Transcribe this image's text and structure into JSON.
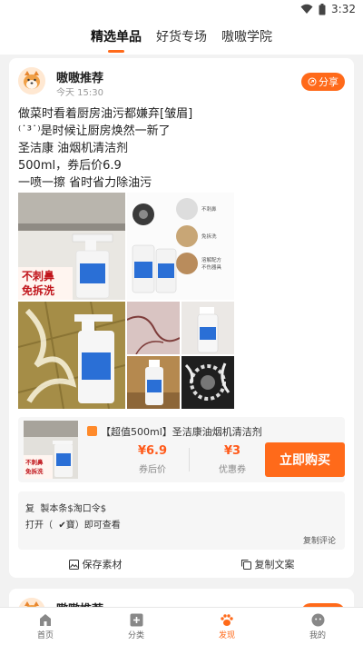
{
  "status_bar": {
    "time": "3:32"
  },
  "top_tabs": [
    {
      "label": "精选单品",
      "active": true
    },
    {
      "label": "好货专场",
      "active": false
    },
    {
      "label": "嗷嗷学院",
      "active": false
    }
  ],
  "post": {
    "author": "嗷嗷推荐",
    "time": "今天 15:30",
    "share_label": "分享",
    "text_lines": [
      "做菜时看着厨房油污都嫌弃[皱眉]",
      "⁽˙³˙⁾是时候让厨房焕然一新了",
      "圣洁康    油烟机清洁剂",
      "500ml，券后价6.9",
      "一喷一擦    省时省力除油污"
    ],
    "image_text": {
      "img1": [
        "不刺鼻",
        "免拆洗"
      ],
      "img2": [
        "不刺鼻",
        "免拆洗",
        "溶解配方",
        "不伤器具"
      ]
    }
  },
  "product": {
    "title": "【超值500ml】圣洁康油烟机清洁剂",
    "thumb_text": [
      "不刺鼻",
      "免拆洗"
    ],
    "after_coupon_price": "¥6.9",
    "after_coupon_label": "券后价",
    "coupon_value": "¥3",
    "coupon_label": "优惠券",
    "buy_label": "立即购买"
  },
  "copy_text": {
    "line1": "复  製本条$淘口令$",
    "line2": "打开（  ✔寶）即可查看",
    "comment_label": "复制评论"
  },
  "actions": {
    "save_label": "保存素材",
    "copy_label": "复制文案"
  },
  "next_post": {
    "author": "嗷嗷推荐"
  },
  "bottom_nav": [
    {
      "label": "首页",
      "icon": "home-icon",
      "active": false
    },
    {
      "label": "分类",
      "icon": "category-icon",
      "active": false
    },
    {
      "label": "发现",
      "icon": "paw-icon",
      "active": true
    },
    {
      "label": "我的",
      "icon": "profile-icon",
      "active": false
    }
  ],
  "colors": {
    "accent": "#ff6a1a"
  }
}
